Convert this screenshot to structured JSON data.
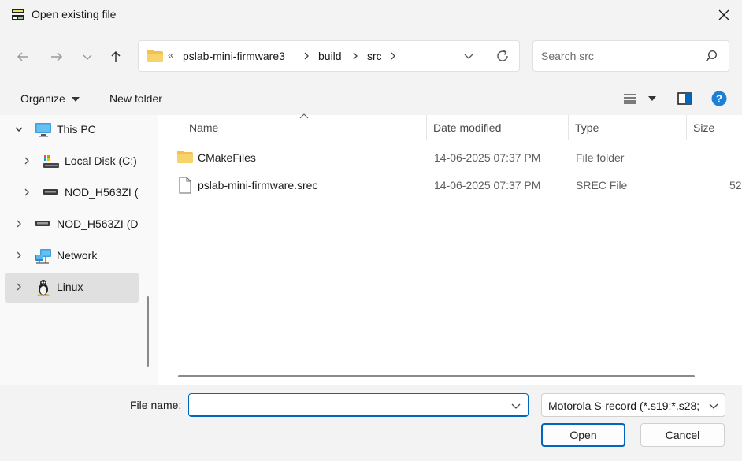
{
  "window": {
    "title": "Open existing file"
  },
  "address": {
    "overflow": "«",
    "crumbs": [
      "pslab-mini-firmware3",
      "build",
      "src"
    ]
  },
  "search": {
    "placeholder": "Search src"
  },
  "commands": {
    "organize": "Organize",
    "new_folder": "New folder"
  },
  "sidebar": {
    "items": [
      {
        "label": "This PC",
        "icon": "pc-icon",
        "expanded": true
      },
      {
        "label": "Local Disk (C:)",
        "icon": "local-disk-icon"
      },
      {
        "label": "NOD_H563ZI (",
        "icon": "drive-icon"
      },
      {
        "label": "NOD_H563ZI (D:",
        "icon": "drive-icon"
      },
      {
        "label": "Network",
        "icon": "network-icon"
      },
      {
        "label": "Linux",
        "icon": "linux-icon",
        "selected": true
      }
    ]
  },
  "columns": {
    "name": "Name",
    "date": "Date modified",
    "type": "Type",
    "size": "Size"
  },
  "files": [
    {
      "name": "CMakeFiles",
      "date": "14-06-2025 07:37 PM",
      "type": "File folder",
      "size": "",
      "icon": "folder-icon"
    },
    {
      "name": "pslab-mini-firmware.srec",
      "date": "14-06-2025 07:37 PM",
      "type": "SREC File",
      "size": "52",
      "icon": "file-icon"
    }
  ],
  "footer": {
    "file_name_label": "File name:",
    "file_name_value": "",
    "file_type": "Motorola S-record (*.s19;*.s28;",
    "open": "Open",
    "cancel": "Cancel"
  },
  "colors": {
    "accent": "#0067c0",
    "folder": "#f2c14e",
    "selection": "#e0e0e0"
  }
}
